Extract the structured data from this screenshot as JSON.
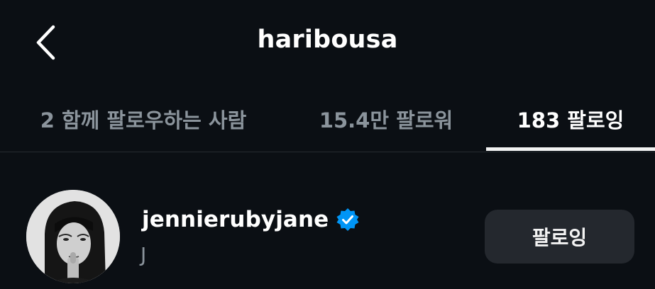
{
  "header": {
    "title": "haribousa",
    "back_icon": "chevron-left-icon"
  },
  "tabs": [
    {
      "label": "2 함께 팔로우하는 사람",
      "active": false
    },
    {
      "label": "15.4만 팔로워",
      "active": false
    },
    {
      "label": "183 팔로잉",
      "active": true
    }
  ],
  "list": [
    {
      "username": "jennierubyjane",
      "verified": true,
      "full_name": "J",
      "action_label": "팔로잉",
      "avatar": "profile-photo"
    }
  ],
  "colors": {
    "background": "#0b0f14",
    "verified_badge": "#0095f6",
    "inactive_tab": "#8b949c",
    "button_bg": "#24282e"
  }
}
